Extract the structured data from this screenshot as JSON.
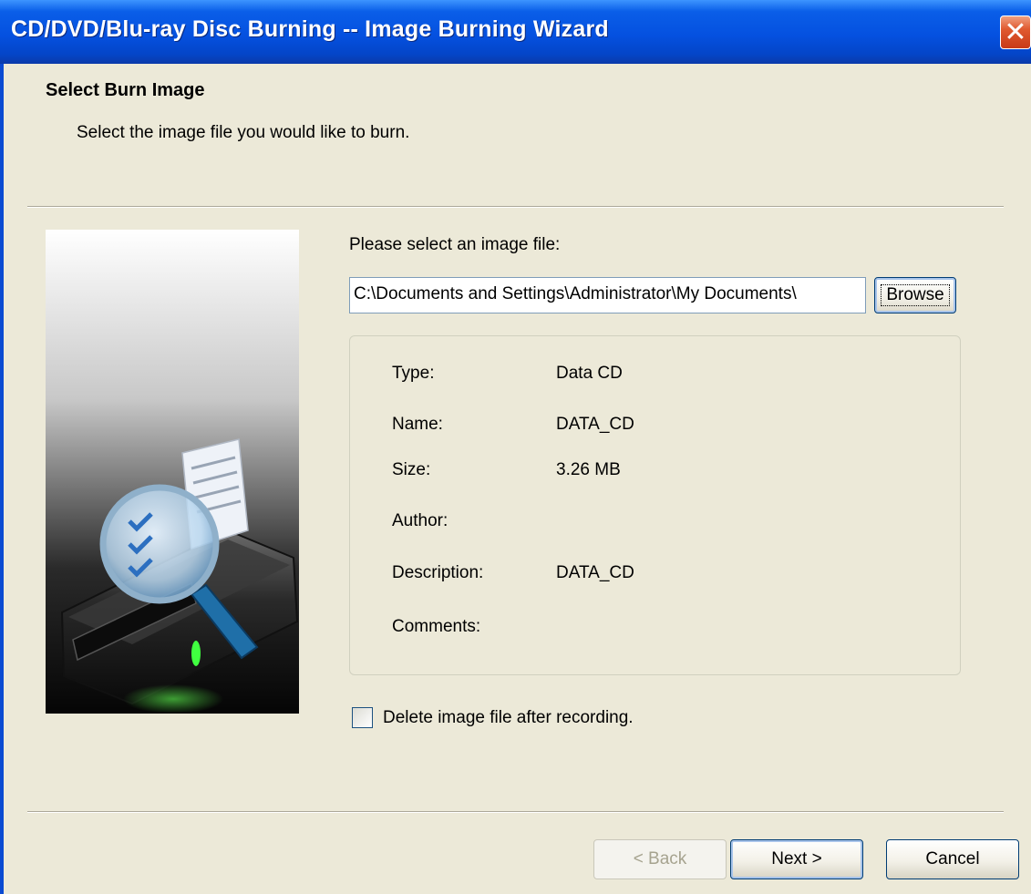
{
  "window": {
    "title": "CD/DVD/Blu-ray Disc Burning  --  Image Burning Wizard",
    "close_symbol": "✕"
  },
  "header": {
    "heading": "Select Burn Image",
    "subheading": "Select the image file you would like to burn."
  },
  "file_selection": {
    "prompt": "Please select an image file:",
    "path_value": "C:\\Documents and Settings\\Administrator\\My Documents\\",
    "browse_label": "Browse"
  },
  "image_info": {
    "type_label": "Type:",
    "type_value": "Data CD",
    "name_label": "Name:",
    "name_value": "DATA_CD",
    "size_label": "Size:",
    "size_value": "3.26 MB",
    "author_label": "Author:",
    "author_value": "",
    "description_label": "Description:",
    "description_value": "DATA_CD",
    "comments_label": "Comments:",
    "comments_value": ""
  },
  "options": {
    "delete_after_label": "Delete image file after recording.",
    "delete_after_checked": false
  },
  "buttons": {
    "back_label": "< Back",
    "next_label": "Next >",
    "cancel_label": "Cancel"
  },
  "icons": {
    "side_image": "disc-drive-magnifier-icon",
    "close": "close-icon"
  },
  "colors": {
    "titlebar": "#0551e0",
    "close_button": "#e05a30",
    "dialog_background": "#ece9d8"
  }
}
